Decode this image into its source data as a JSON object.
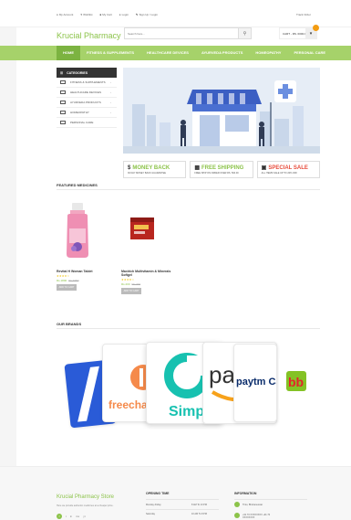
{
  "topbar": {
    "links": [
      {
        "icon": "user-icon",
        "label": "My Account"
      },
      {
        "icon": "heart-icon",
        "label": "Wishlist"
      },
      {
        "icon": "cart-icon",
        "label": "My Cart"
      },
      {
        "icon": "lock-icon",
        "label": "Login"
      },
      {
        "icon": "pencil-icon",
        "label": "Sign Up / Login"
      }
    ],
    "track": "Track Order"
  },
  "header": {
    "logo": "Krucial Pharmacy",
    "search_placeholder": "Search here...",
    "cart_label": "CART - RS. 0000.00"
  },
  "nav": {
    "items": [
      "HOME",
      "FITNESS & SUPPLEMENTS",
      "HEALTHCARE DEVICES",
      "AYURVEDA PRODUCTS",
      "HOMEOPATHY",
      "PERSONAL CARE"
    ]
  },
  "categories": {
    "title": "CATEGORIES",
    "items": [
      "FITNESS & SUPPLEMENTS",
      "HEALTHCARE DEVICES",
      "AYURVEDA PRODUCTS",
      "HOMEOPATHY",
      "PERSONAL CARE"
    ]
  },
  "promos": [
    {
      "icon": "dollar-icon",
      "title": "MONEY BACK",
      "sub": "30 DAY MONEY BACK GUARANTEE"
    },
    {
      "icon": "truck-icon",
      "title": "FREE SHIPPING",
      "sub": "FREE SHIP ON ORDER OVER RS. 500.00"
    },
    {
      "icon": "gift-icon",
      "title": "SPECIAL SALE",
      "sub": "ALL ITEMS SALE UP TO 20% OFF"
    }
  ],
  "featured": {
    "title": "FEATURED MEDICINES",
    "products": [
      {
        "name": "Revital H Woman Tablet",
        "stars": "★★★★☆",
        "price": "Rs.1800",
        "old_price": "Rs.1950",
        "button": "ADD TO CART"
      },
      {
        "name": "Maxirich Multivitamin & Minerals Softgel",
        "stars": "★★★★☆",
        "price": "Rs.200",
        "old_price": "Rs.220",
        "button": "ADD TO CART"
      }
    ]
  },
  "brands": {
    "title": "OUR BRANDS",
    "names": [
      "freecharge",
      "Simpl",
      "paytm",
      "paytm Cash POINTS",
      "bb"
    ]
  },
  "footer": {
    "store": "Krucial Pharmacy Store",
    "desc": "Here we provide authentic medicines at a cheaper price.",
    "social": [
      "f",
      "t",
      "in",
      "rss",
      "yt"
    ],
    "opening_title": "OPENING TIME",
    "opening_rows": [
      {
        "day": "Monday-Friday",
        "time": "8 AM To 10 PM"
      },
      {
        "day": "Saturday",
        "time": "10 AM To 8 PM"
      }
    ],
    "info_title": "INFORMATION",
    "info_rows": [
      "Tinto, Bhubaneswar",
      "+91 70 XXXXXXXX +91 70 XXXXXXXX"
    ]
  },
  "colors": {
    "accent": "#8cc34a",
    "nav": "#a6d26a",
    "sale": "#e74c3c"
  }
}
